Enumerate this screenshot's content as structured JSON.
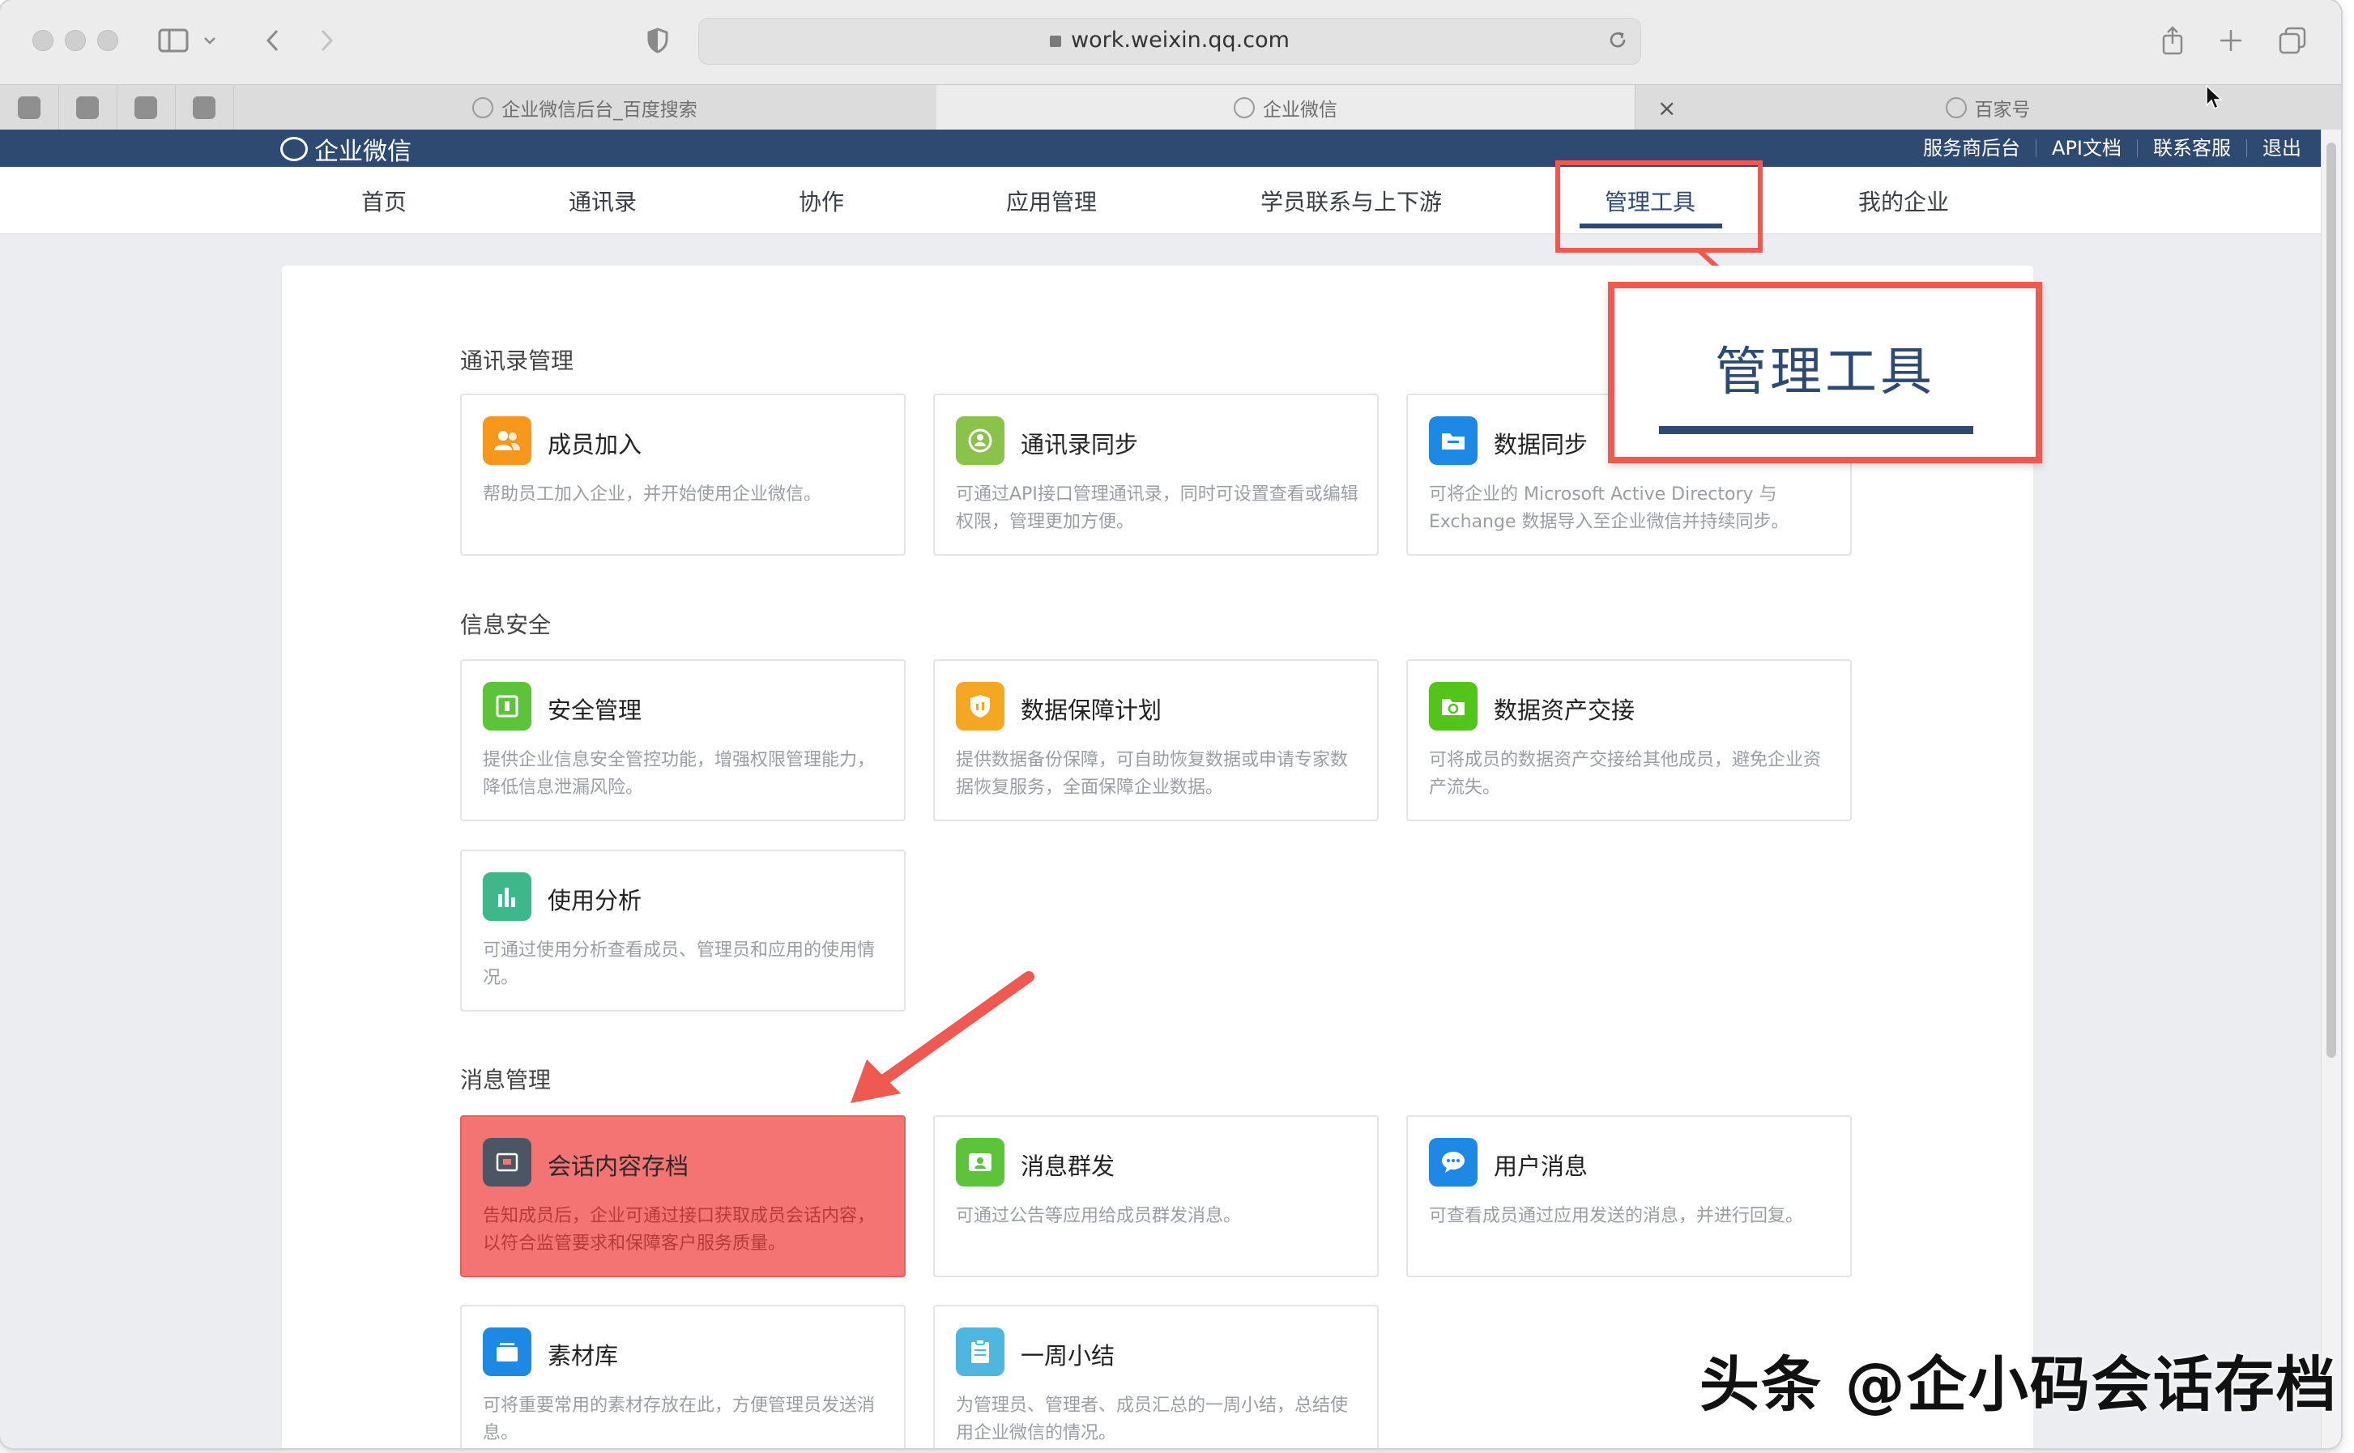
{
  "browser": {
    "url": "work.weixin.qq.com",
    "tabs": [
      {
        "label": "企业微信后台_百度搜索",
        "active": false
      },
      {
        "label": "企业微信",
        "active": true
      },
      {
        "label": "百家号",
        "active": false
      }
    ],
    "close_glyph": "×"
  },
  "site": {
    "brand": "企业微信",
    "top_links": [
      "服务商后台",
      "API文档",
      "联系客服",
      "退出"
    ],
    "nav": [
      "首页",
      "通讯录",
      "协作",
      "应用管理",
      "学员联系与上下游",
      "管理工具",
      "我的企业"
    ],
    "active_nav": "管理工具"
  },
  "callout": {
    "label": "管理工具"
  },
  "sections": [
    {
      "title": "通讯录管理",
      "cards": [
        {
          "title": "成员加入",
          "desc": "帮助员工加入企业，并开始使用企业微信。",
          "icon": "users-icon",
          "color": "#f7981d"
        },
        {
          "title": "通讯录同步",
          "desc": "可通过API接口管理通讯录，同时可设置查看或编辑权限，管理更加方便。",
          "icon": "sync-contacts-icon",
          "color": "#8bc34a"
        },
        {
          "title": "数据同步",
          "desc": "可将企业的 Microsoft Active Directory 与 Exchange 数据导入至企业微信并持续同步。",
          "icon": "folder-sync-icon",
          "color": "#1e88e5"
        }
      ]
    },
    {
      "title": "信息安全",
      "cards": [
        {
          "title": "安全管理",
          "desc": "提供企业信息安全管控功能，增强权限管理能力，降低信息泄漏风险。",
          "icon": "security-icon",
          "color": "#5cc33b"
        },
        {
          "title": "数据保障计划",
          "desc": "提供数据备份保障，可自助恢复数据或申请专家数据恢复服务，全面保障企业数据。",
          "icon": "shield-icon",
          "color": "#f5a623"
        },
        {
          "title": "数据资产交接",
          "desc": "可将成员的数据资产交接给其他成员，避免企业资产流失。",
          "icon": "handover-icon",
          "color": "#52c41a"
        },
        {
          "title": "使用分析",
          "desc": "可通过使用分析查看成员、管理员和应用的使用情况。",
          "icon": "analytics-icon",
          "color": "#3eb88a"
        }
      ]
    },
    {
      "title": "消息管理",
      "cards": [
        {
          "title": "会话内容存档",
          "desc": "告知成员后，企业可通过接口获取成员会话内容，以符合监管要求和保障客户服务质量。",
          "icon": "archive-icon",
          "color": "#4b5563"
        },
        {
          "title": "消息群发",
          "desc": "可通过公告等应用给成员群发消息。",
          "icon": "broadcast-icon",
          "color": "#5cc33b"
        },
        {
          "title": "用户消息",
          "desc": "可查看成员通过应用发送的消息，并进行回复。",
          "icon": "chat-icon",
          "color": "#1e88e5"
        },
        {
          "title": "素材库",
          "desc": "可将重要常用的素材存放在此，方便管理员发送消息。",
          "icon": "library-icon",
          "color": "#1e88e5"
        },
        {
          "title": "一周小结",
          "desc": "为管理员、管理者、成员汇总的一周小结，总结使用企业微信的情况。",
          "icon": "clipboard-icon",
          "color": "#4fb6e0"
        }
      ]
    }
  ],
  "watermark": "头条 @企小码会话存档"
}
